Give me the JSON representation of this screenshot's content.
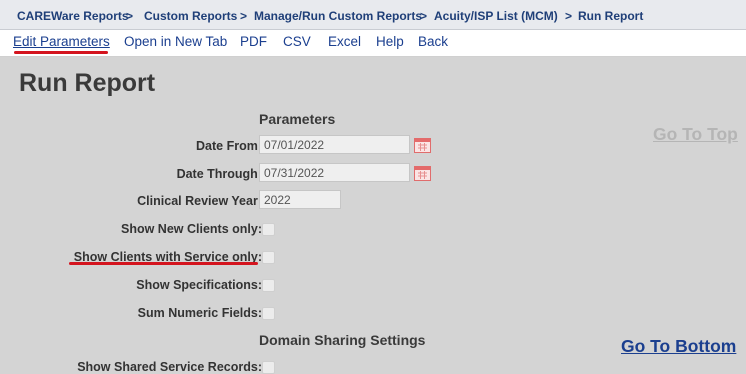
{
  "breadcrumb": {
    "items": [
      "CAREWare Reports",
      "Custom Reports",
      "Manage/Run Custom Reports",
      "Acuity/ISP List (MCM)",
      "Run Report"
    ],
    "separator": ">"
  },
  "toolbar": {
    "items": [
      "Edit Parameters",
      "Open in New Tab",
      "PDF",
      "CSV",
      "Excel",
      "Help",
      "Back"
    ]
  },
  "page": {
    "title": "Run Report"
  },
  "parameters": {
    "heading": "Parameters",
    "date_from": {
      "label": "Date From:",
      "value": "07/01/2022"
    },
    "date_through": {
      "label": "Date Through:",
      "value": "07/31/2022"
    },
    "clinical_review_year": {
      "label": "Clinical Review Year:",
      "value": "2022"
    },
    "show_new_clients_only": {
      "label": "Show New Clients only:",
      "checked": false
    },
    "show_clients_with_service_only": {
      "label": "Show Clients with Service only:",
      "checked": false
    },
    "show_specifications": {
      "label": "Show Specifications:",
      "checked": false
    },
    "sum_numeric_fields": {
      "label": "Sum Numeric Fields:",
      "checked": false
    }
  },
  "domain_sharing": {
    "heading": "Domain Sharing Settings",
    "show_shared_service_records": {
      "label": "Show Shared Service Records:",
      "checked": false
    }
  },
  "navigation": {
    "go_to_top": "Go To Top",
    "go_to_bottom": "Go To Bottom"
  },
  "colors": {
    "link": "#1b3f8f",
    "annotation_underline": "#d4141e",
    "background": "#d4d4d4"
  },
  "icons": {
    "calendar": "calendar-icon"
  }
}
